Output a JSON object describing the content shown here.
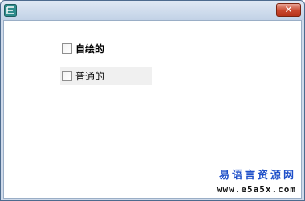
{
  "window": {
    "close_glyph": "✕",
    "app_icon": "app-icon"
  },
  "checkboxes": [
    {
      "label": "自绘的",
      "checked": false
    },
    {
      "label": "普通的",
      "checked": false
    }
  ],
  "watermark": {
    "title": "易语言资源网",
    "url": "www.e5a5x.com"
  }
}
